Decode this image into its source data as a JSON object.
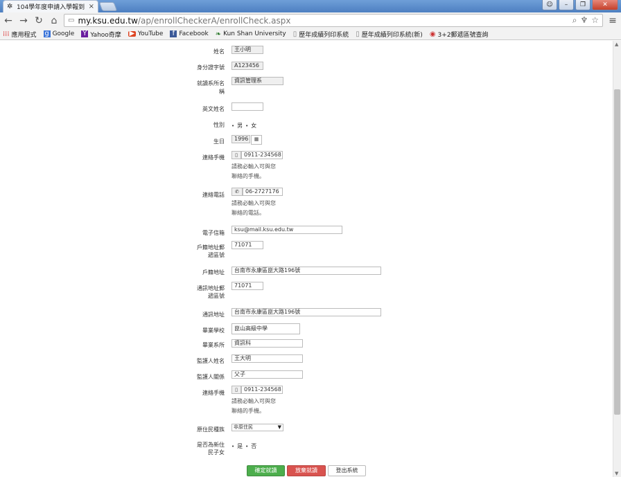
{
  "browser": {
    "tab_title": "104學年度申請入學報到",
    "tab_close": "×",
    "url_host": "my.ksu.edu.tw",
    "url_path": "/ap/enrollCheckerA/enrollCheck.aspx",
    "bookmarks": [
      {
        "label": "應用程式",
        "icon": "apps-icon"
      },
      {
        "label": "Google",
        "icon": "google-icon"
      },
      {
        "label": "Yahoo奇摩",
        "icon": "yahoo-icon"
      },
      {
        "label": "YouTube",
        "icon": "youtube-icon"
      },
      {
        "label": "Facebook",
        "icon": "facebook-icon"
      },
      {
        "label": "Kun Shan University",
        "icon": "ksu-icon"
      },
      {
        "label": "歷年成績列印系統",
        "icon": "page-icon"
      },
      {
        "label": "歷年成績列印系統(新)",
        "icon": "page-icon"
      },
      {
        "label": "3+2郵遞區號查詢",
        "icon": "round-icon"
      }
    ]
  },
  "form": {
    "name": {
      "label": "姓名",
      "value": "王小明"
    },
    "id_number": {
      "label": "身分證字號",
      "value": "A123456"
    },
    "department": {
      "label": "就讀系所名稱",
      "value": "資訊管理系"
    },
    "english_name": {
      "label": "英文姓名",
      "value": ""
    },
    "gender": {
      "label": "性別",
      "options": [
        "男",
        "女"
      ]
    },
    "birthday": {
      "label": "生日",
      "value": "1996"
    },
    "mobile": {
      "label": "連絡手機",
      "value": "0911-234568",
      "hint_1": "請務必輸入可與您",
      "hint_2": "聯絡的手機。"
    },
    "phone": {
      "label": "連絡電話",
      "value": "06-2727176",
      "hint_1": "請務必輸入可與您",
      "hint_2": "聯絡的電話。"
    },
    "email": {
      "label": "電子信箱",
      "value": "ksu@mail.ksu.edu.tw"
    },
    "reg_zip": {
      "label": "戶籍地址郵遞區號",
      "value": "71071"
    },
    "reg_address": {
      "label": "戶籍地址",
      "value": "台南市永康區崑大路196號"
    },
    "mail_zip": {
      "label": "通訊地址郵遞區號",
      "value": "71071"
    },
    "mail_address": {
      "label": "通訊地址",
      "value": "台南市永康區崑大路196號"
    },
    "grad_school": {
      "label": "畢業學校",
      "value": "崑山高級中學"
    },
    "grad_dept": {
      "label": "畢業系所",
      "value": "資訊科"
    },
    "guardian_name": {
      "label": "監護人姓名",
      "value": "王大明"
    },
    "guardian_relation": {
      "label": "監護人關係",
      "value": "父子"
    },
    "guardian_mobile": {
      "label": "連絡手機",
      "value": "0911-234568",
      "hint_1": "請務必輸入可與您",
      "hint_2": "聯絡的手機。"
    },
    "aboriginal": {
      "label": "原住民種族",
      "value": "非原住民"
    },
    "new_immigrant": {
      "label": "是否為新住民子女",
      "options": [
        "是",
        "否"
      ]
    }
  },
  "buttons": {
    "confirm": "確定就讀",
    "give_up": "放棄就讀",
    "logout": "登出系統"
  }
}
